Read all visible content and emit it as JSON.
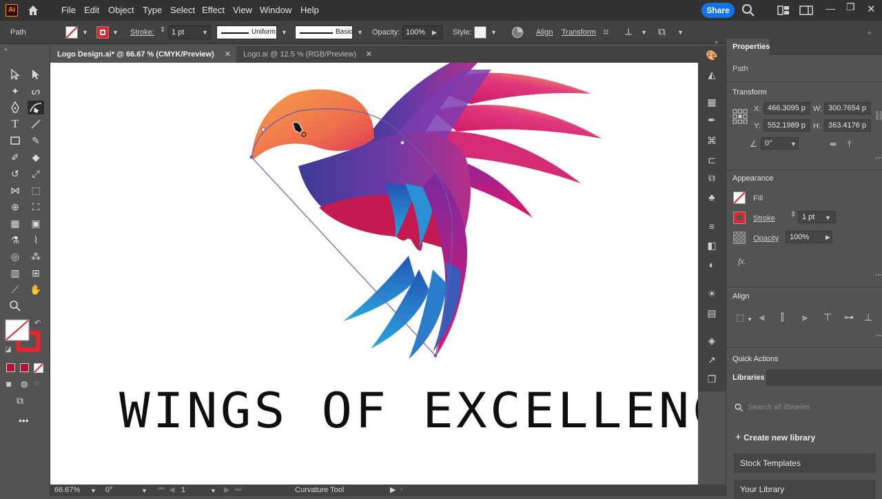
{
  "menubar": {
    "app_logo": "Ai",
    "items": [
      "File",
      "Edit",
      "Object",
      "Type",
      "Select",
      "Effect",
      "View",
      "Window",
      "Help"
    ],
    "share_label": "Share"
  },
  "controlbar": {
    "object_type": "Path",
    "stroke_label": "Stroke:",
    "stroke_weight": "1 pt",
    "profile_uniform": "Uniform",
    "brush_basic": "Basic",
    "opacity_label": "Opacity:",
    "opacity_value": "100%",
    "style_label": "Style:",
    "align_label": "Align",
    "transform_label": "Transform"
  },
  "tabs": [
    {
      "label": "Logo Design.ai* @ 66.67 % (CMYK/Preview)",
      "active": true
    },
    {
      "label": "Logo.ai @ 12.5 % (RGB/Preview)",
      "active": false
    }
  ],
  "canvas": {
    "artwork_text": "WINGS OF EXCELLENCE"
  },
  "statusbar": {
    "zoom": "66.67%",
    "rotation": "0°",
    "artboard_num": "1",
    "current_tool": "Curvature Tool"
  },
  "properties": {
    "title": "Properties",
    "object_type": "Path",
    "transform": {
      "header": "Transform",
      "x_label": "X:",
      "x_value": "466.3095 p",
      "y_label": "Y:",
      "y_value": "552.1989 p",
      "w_label": "W:",
      "w_value": "300.7654 p",
      "h_label": "H:",
      "h_value": "363.4176 p",
      "angle_value": "0°"
    },
    "appearance": {
      "header": "Appearance",
      "fill_label": "Fill",
      "stroke_label": "Stroke",
      "stroke_value": "1 pt",
      "opacity_label": "Opacity",
      "opacity_value": "100%",
      "fx_label": "fx."
    },
    "align_header": "Align",
    "quick_actions": "Quick Actions"
  },
  "libraries": {
    "title": "Libraries",
    "search_placeholder": "Search all libraries",
    "create_label": "Create new library",
    "items": [
      "Stock Templates",
      "Your Library"
    ]
  },
  "colors": {
    "stroke_swatch": "#e3262d",
    "accent_blue": "#1473e6",
    "selection_path": "#6b5bb0"
  }
}
